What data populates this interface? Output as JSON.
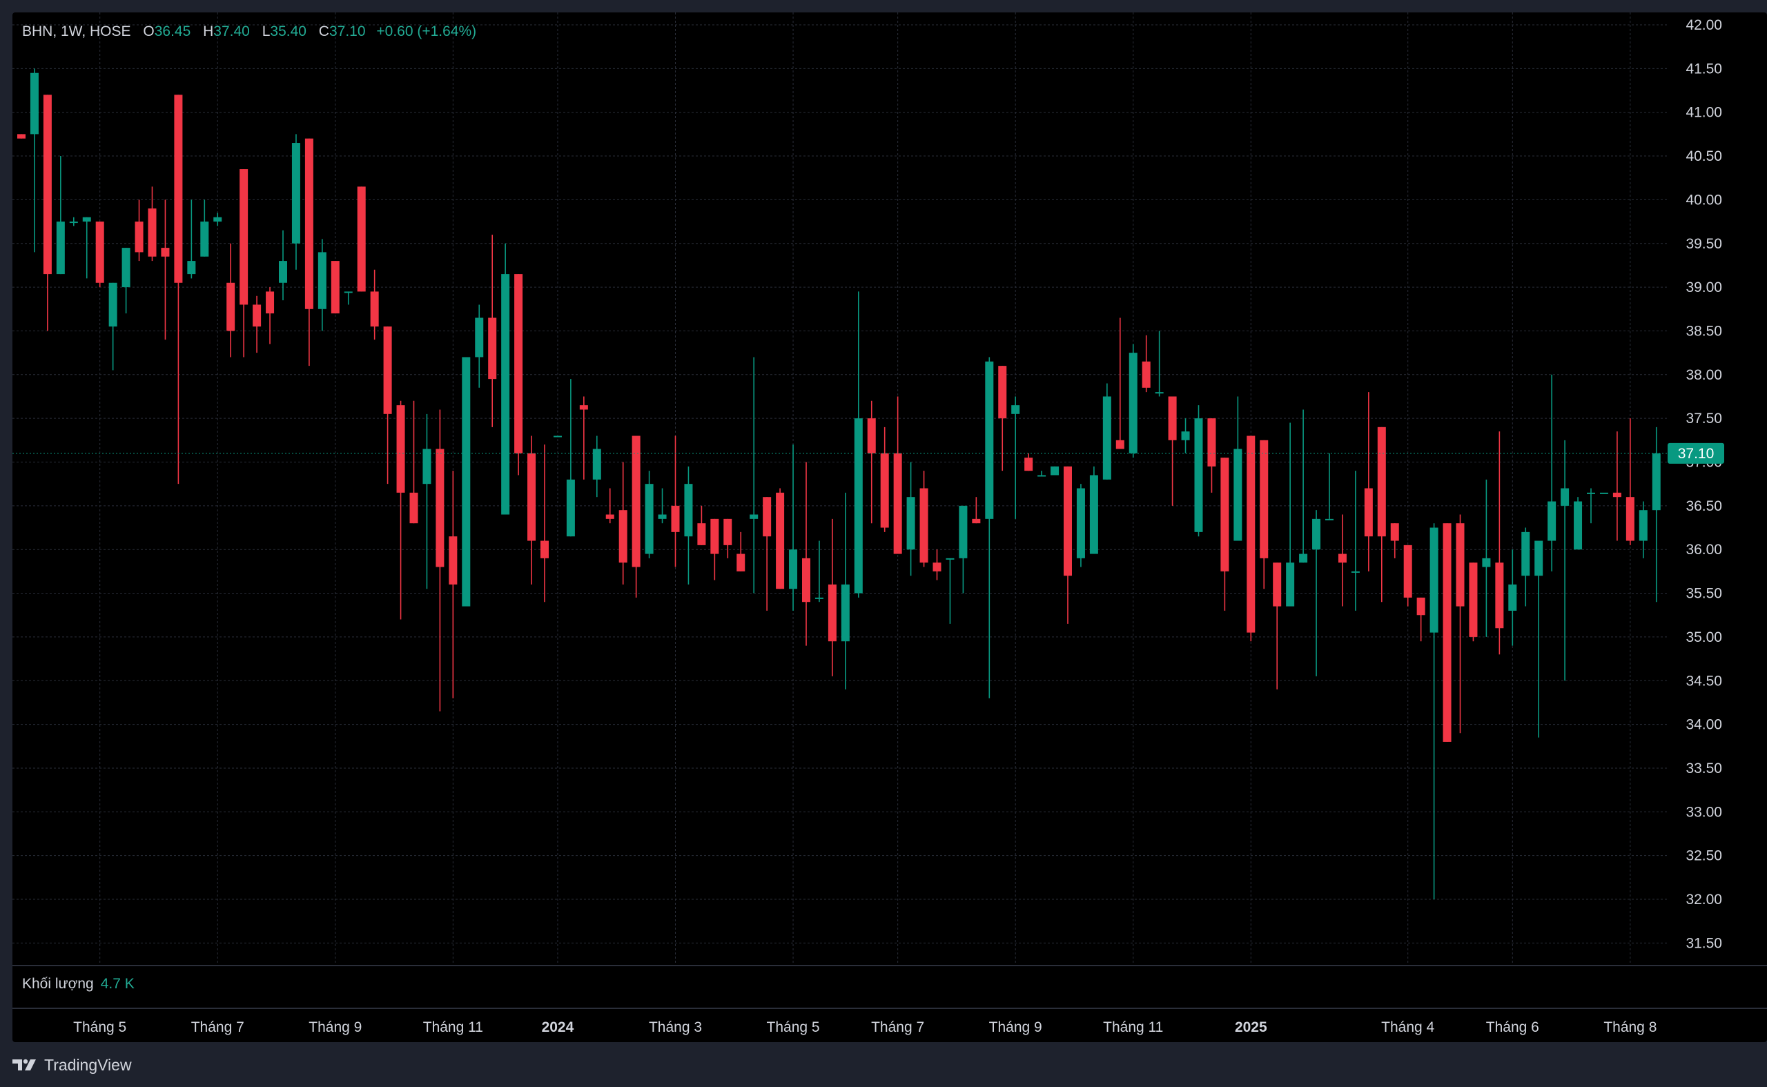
{
  "header": {
    "symbol": "BHN, 1W, HOSE",
    "open_label": "O",
    "open_value": "36.45",
    "high_label": "H",
    "high_value": "37.40",
    "low_label": "L",
    "low_value": "35.40",
    "close_label": "C",
    "close_value": "37.10",
    "change": "+0.60 (+1.64%)"
  },
  "volume": {
    "label": "Khối lượng",
    "value": "4.7 K"
  },
  "last_price_label": "37.10",
  "brand": {
    "name": "TradingView",
    "icon": "tradingview-logo-icon"
  },
  "colors": {
    "up": "#089981",
    "down": "#f23645",
    "background": "#000000",
    "grid": "#2a2e39",
    "text": "#d1d4dc",
    "price_tag": "#089981"
  },
  "chart_data": {
    "type": "candlestick",
    "interval": "1W",
    "ylim": [
      31.2,
      42.15
    ],
    "y_ticks": [
      "42.00",
      "41.50",
      "41.00",
      "40.50",
      "40.00",
      "39.50",
      "39.00",
      "38.50",
      "38.00",
      "37.50",
      "37.00",
      "36.50",
      "36.00",
      "35.50",
      "35.00",
      "34.50",
      "34.00",
      "33.50",
      "33.00",
      "32.50",
      "32.00",
      "31.50"
    ],
    "x_ticks": [
      {
        "label": "Tháng 5",
        "index": 6,
        "bold": false
      },
      {
        "label": "Tháng 7",
        "index": 15,
        "bold": false
      },
      {
        "label": "Tháng 9",
        "index": 24,
        "bold": false
      },
      {
        "label": "Tháng 11",
        "index": 33,
        "bold": false
      },
      {
        "label": "2024",
        "index": 41,
        "bold": true
      },
      {
        "label": "Tháng 3",
        "index": 50,
        "bold": false
      },
      {
        "label": "Tháng 5",
        "index": 59,
        "bold": false
      },
      {
        "label": "Tháng 7",
        "index": 67,
        "bold": false
      },
      {
        "label": "Tháng 9",
        "index": 76,
        "bold": false
      },
      {
        "label": "Tháng 11",
        "index": 85,
        "bold": false
      },
      {
        "label": "2025",
        "index": 94,
        "bold": true
      },
      {
        "label": "Tháng 4",
        "index": 106,
        "bold": false
      },
      {
        "label": "Tháng 6",
        "index": 114,
        "bold": false
      },
      {
        "label": "Tháng 8",
        "index": 123,
        "bold": false
      }
    ],
    "candles": [
      [
        40.75,
        40.75,
        40.7,
        40.7
      ],
      [
        40.75,
        41.5,
        39.4,
        41.45
      ],
      [
        41.2,
        41.2,
        38.5,
        39.15
      ],
      [
        39.15,
        40.5,
        39.15,
        39.75
      ],
      [
        39.75,
        39.8,
        39.7,
        39.75
      ],
      [
        39.75,
        39.8,
        39.1,
        39.8
      ],
      [
        39.75,
        39.75,
        39.0,
        39.05
      ],
      [
        38.55,
        39.05,
        38.05,
        39.05
      ],
      [
        39.0,
        39.45,
        38.7,
        39.45
      ],
      [
        39.75,
        40.0,
        39.3,
        39.4
      ],
      [
        39.9,
        40.15,
        39.3,
        39.35
      ],
      [
        39.45,
        40.0,
        38.4,
        39.35
      ],
      [
        41.2,
        41.2,
        36.75,
        39.05
      ],
      [
        39.15,
        40.0,
        39.1,
        39.3
      ],
      [
        39.35,
        40.0,
        39.35,
        39.75
      ],
      [
        39.75,
        39.85,
        39.7,
        39.8
      ],
      [
        39.05,
        39.5,
        38.2,
        38.5
      ],
      [
        40.35,
        40.35,
        38.2,
        38.8
      ],
      [
        38.8,
        38.9,
        38.25,
        38.55
      ],
      [
        38.95,
        39.0,
        38.35,
        38.7
      ],
      [
        39.05,
        39.65,
        38.85,
        39.3
      ],
      [
        39.5,
        40.75,
        39.2,
        40.65
      ],
      [
        40.7,
        40.7,
        38.1,
        38.75
      ],
      [
        38.75,
        39.55,
        38.5,
        39.4
      ],
      [
        39.3,
        39.3,
        38.7,
        38.7
      ],
      [
        38.95,
        38.95,
        38.8,
        38.95
      ],
      [
        40.15,
        40.15,
        38.95,
        38.95
      ],
      [
        38.95,
        39.2,
        38.4,
        38.55
      ],
      [
        38.55,
        38.55,
        36.75,
        37.55
      ],
      [
        37.65,
        37.7,
        35.2,
        36.65
      ],
      [
        36.65,
        37.7,
        36.3,
        36.3
      ],
      [
        36.75,
        37.55,
        35.55,
        37.15
      ],
      [
        37.15,
        37.6,
        34.15,
        35.8
      ],
      [
        36.15,
        36.9,
        34.3,
        35.6
      ],
      [
        35.35,
        38.2,
        35.35,
        38.2
      ],
      [
        38.2,
        38.8,
        37.85,
        38.65
      ],
      [
        38.65,
        39.6,
        37.4,
        37.95
      ],
      [
        36.4,
        39.5,
        36.4,
        39.15
      ],
      [
        39.15,
        39.15,
        36.85,
        37.1
      ],
      [
        37.1,
        37.3,
        35.6,
        36.1
      ],
      [
        36.1,
        37.2,
        35.4,
        35.9
      ],
      [
        37.3,
        37.3,
        37.3,
        37.3
      ],
      [
        36.15,
        37.95,
        36.15,
        36.8
      ],
      [
        37.65,
        37.75,
        36.8,
        37.6
      ],
      [
        36.8,
        37.3,
        36.6,
        37.15
      ],
      [
        36.4,
        36.7,
        36.3,
        36.35
      ],
      [
        36.45,
        37.0,
        35.6,
        35.85
      ],
      [
        37.3,
        37.3,
        35.45,
        35.8
      ],
      [
        35.95,
        36.9,
        35.9,
        36.75
      ],
      [
        36.35,
        36.7,
        36.3,
        36.4
      ],
      [
        36.5,
        37.3,
        35.8,
        36.2
      ],
      [
        36.15,
        36.95,
        35.6,
        36.75
      ],
      [
        36.3,
        36.5,
        36.05,
        36.05
      ],
      [
        36.35,
        36.35,
        35.65,
        35.95
      ],
      [
        36.35,
        36.35,
        35.9,
        36.05
      ],
      [
        35.95,
        36.2,
        35.75,
        35.75
      ],
      [
        36.35,
        38.2,
        35.5,
        36.4
      ],
      [
        36.6,
        36.6,
        35.3,
        36.15
      ],
      [
        36.65,
        36.7,
        35.55,
        35.55
      ],
      [
        35.55,
        37.2,
        35.3,
        36.0
      ],
      [
        35.9,
        37.0,
        34.9,
        35.4
      ],
      [
        35.45,
        36.1,
        35.4,
        35.45
      ],
      [
        35.6,
        36.35,
        34.55,
        34.95
      ],
      [
        34.95,
        36.65,
        34.4,
        35.6
      ],
      [
        35.5,
        38.95,
        35.45,
        37.5
      ],
      [
        37.5,
        37.7,
        36.3,
        37.1
      ],
      [
        37.1,
        37.4,
        36.2,
        36.25
      ],
      [
        37.1,
        37.75,
        35.95,
        35.95
      ],
      [
        36.0,
        37.0,
        35.7,
        36.6
      ],
      [
        36.7,
        36.9,
        35.8,
        35.85
      ],
      [
        35.85,
        36.0,
        35.65,
        35.75
      ],
      [
        35.9,
        35.9,
        35.15,
        35.9
      ],
      [
        35.9,
        36.5,
        35.5,
        36.5
      ],
      [
        36.35,
        36.6,
        36.3,
        36.3
      ],
      [
        36.35,
        38.2,
        34.3,
        38.15
      ],
      [
        38.1,
        38.1,
        36.9,
        37.5
      ],
      [
        37.55,
        37.75,
        36.35,
        37.65
      ],
      [
        37.05,
        37.1,
        36.9,
        36.9
      ],
      [
        36.85,
        36.9,
        36.85,
        36.85
      ],
      [
        36.85,
        36.95,
        36.85,
        36.95
      ],
      [
        36.95,
        36.95,
        35.15,
        35.7
      ],
      [
        35.9,
        36.75,
        35.8,
        36.7
      ],
      [
        35.95,
        36.95,
        35.95,
        36.85
      ],
      [
        36.8,
        37.9,
        36.8,
        37.75
      ],
      [
        37.25,
        38.65,
        37.2,
        37.15
      ],
      [
        37.1,
        38.35,
        37.05,
        38.25
      ],
      [
        38.15,
        38.45,
        37.8,
        37.85
      ],
      [
        37.8,
        38.5,
        37.75,
        37.8
      ],
      [
        37.75,
        37.75,
        36.5,
        37.25
      ],
      [
        37.25,
        37.5,
        37.1,
        37.35
      ],
      [
        36.2,
        37.65,
        36.15,
        37.5
      ],
      [
        37.5,
        37.5,
        36.65,
        36.95
      ],
      [
        37.05,
        37.05,
        35.3,
        35.75
      ],
      [
        36.1,
        37.75,
        36.1,
        37.15
      ],
      [
        37.3,
        37.3,
        34.95,
        35.05
      ],
      [
        37.25,
        37.25,
        35.55,
        35.9
      ],
      [
        35.85,
        35.85,
        34.4,
        35.35
      ],
      [
        35.35,
        37.45,
        35.35,
        35.85
      ],
      [
        35.85,
        37.6,
        35.85,
        35.95
      ],
      [
        36.0,
        36.45,
        34.55,
        36.35
      ],
      [
        36.35,
        37.1,
        36.35,
        36.35
      ],
      [
        35.95,
        36.4,
        35.35,
        35.85
      ],
      [
        35.75,
        36.9,
        35.3,
        35.75
      ],
      [
        36.7,
        37.8,
        35.75,
        36.15
      ],
      [
        37.4,
        37.4,
        35.4,
        36.15
      ],
      [
        36.3,
        36.3,
        35.9,
        36.1
      ],
      [
        36.05,
        36.05,
        35.35,
        35.45
      ],
      [
        35.45,
        35.45,
        34.95,
        35.25
      ],
      [
        35.05,
        36.3,
        32.0,
        36.25
      ],
      [
        36.3,
        36.3,
        33.8,
        33.8
      ],
      [
        36.3,
        36.4,
        33.9,
        35.35
      ],
      [
        35.85,
        35.85,
        34.95,
        35.0
      ],
      [
        35.8,
        36.8,
        35.0,
        35.9
      ],
      [
        35.85,
        37.35,
        34.8,
        35.1
      ],
      [
        35.3,
        36.0,
        34.9,
        35.6
      ],
      [
        35.7,
        36.25,
        35.35,
        36.2
      ],
      [
        35.7,
        35.75,
        33.85,
        36.1
      ],
      [
        36.1,
        38.0,
        35.75,
        36.55
      ],
      [
        36.5,
        37.25,
        34.5,
        36.7
      ],
      [
        36.0,
        36.6,
        36.0,
        36.55
      ],
      [
        36.65,
        36.7,
        36.3,
        36.65
      ],
      [
        36.65,
        36.65,
        36.65,
        36.65
      ],
      [
        36.65,
        37.35,
        36.1,
        36.6
      ],
      [
        36.6,
        37.5,
        36.05,
        36.1
      ],
      [
        36.1,
        36.55,
        35.9,
        36.45
      ],
      [
        36.45,
        37.4,
        35.4,
        37.1
      ]
    ]
  }
}
